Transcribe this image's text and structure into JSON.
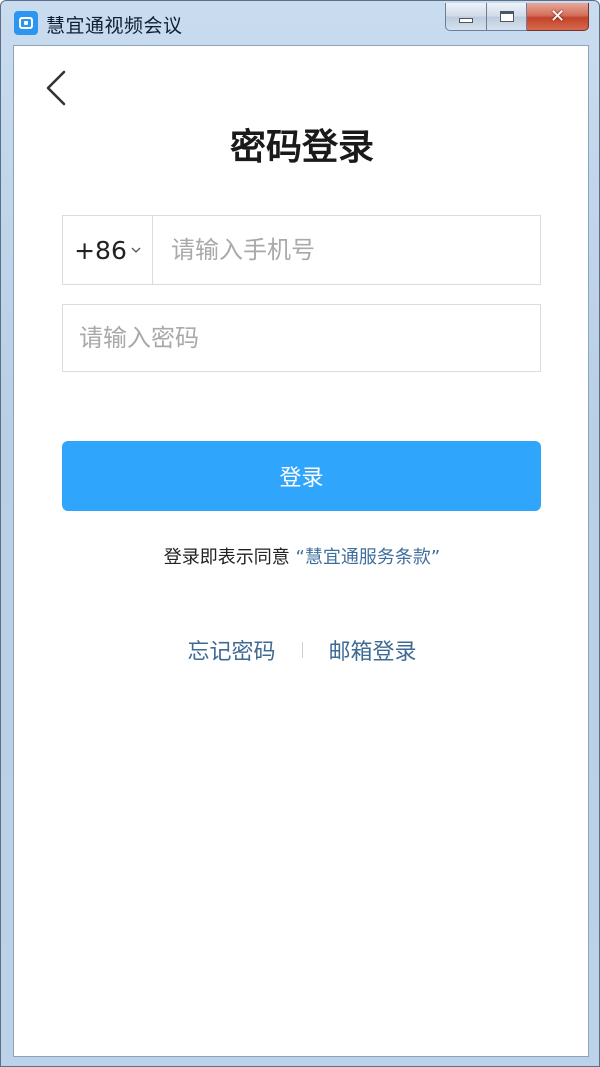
{
  "window": {
    "title": "慧宜通视频会议",
    "close_symbol": "✕"
  },
  "page": {
    "title": "密码登录"
  },
  "form": {
    "country_code": "+86",
    "phone_placeholder": "请输入手机号",
    "password_placeholder": "请输入密码",
    "login_label": "登录"
  },
  "agreement": {
    "prefix": "登录即表示同意",
    "terms_link": "“慧宜通服务条款”"
  },
  "links": {
    "forgot_password": "忘记密码",
    "email_login": "邮箱登录"
  },
  "colors": {
    "primary": "#2fa5fb",
    "link": "#3e6a94"
  },
  "icons": {
    "app": "app-logo-icon",
    "back": "chevron-left-icon",
    "country_dropdown": "chevron-down-icon"
  }
}
